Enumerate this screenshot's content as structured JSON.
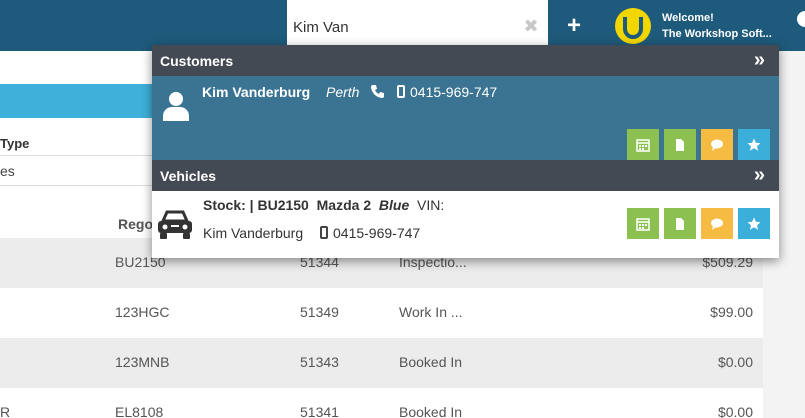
{
  "search": {
    "value": "Kim Van"
  },
  "header": {
    "welcome": "Welcome!",
    "company": "The Workshop Soft..."
  },
  "page": {
    "type_label": "Type",
    "type_value": "es",
    "rego_header": "Rego",
    "rows": [
      {
        "prefix": "",
        "rego": "BU2150",
        "job": "51344",
        "status": "Inspectio...",
        "amount": "$509.29"
      },
      {
        "prefix": "",
        "rego": "123HGC",
        "job": "51349",
        "status": "Work In ...",
        "amount": "$99.00"
      },
      {
        "prefix": "",
        "rego": "123MNB",
        "job": "51343",
        "status": "Booked In",
        "amount": "$0.00"
      },
      {
        "prefix": "R",
        "rego": "EL8108",
        "job": "51341",
        "status": "Booked In",
        "amount": "$0.00"
      }
    ]
  },
  "dropdown": {
    "customers_title": "Customers",
    "vehicles_title": "Vehicles",
    "expand_glyph": "»",
    "customer": {
      "name": "Kim Vanderburg",
      "city": "Perth",
      "mobile": "0415-969-747"
    },
    "vehicle": {
      "stock_label": "Stock: | BU2150",
      "model": "Mazda 2",
      "color": "Blue",
      "vin_label": "VIN:",
      "owner": "Kim Vanderburg",
      "mobile": "0415-969-747"
    }
  },
  "colors": {
    "topbar": "#1e5a7b",
    "section_header": "#444a53",
    "customer_row": "#3b7493",
    "btn_green": "#8cc152",
    "btn_yellow": "#f6bb42",
    "btn_blue": "#3bafda",
    "logo_yellow": "#f2d600"
  },
  "icons": [
    "clear-icon",
    "plus-icon",
    "logo-icon",
    "person-icon",
    "phone-icon",
    "mobile-icon",
    "car-icon",
    "calendar-icon",
    "document-icon",
    "comment-icon",
    "star-icon",
    "expand-icon"
  ]
}
